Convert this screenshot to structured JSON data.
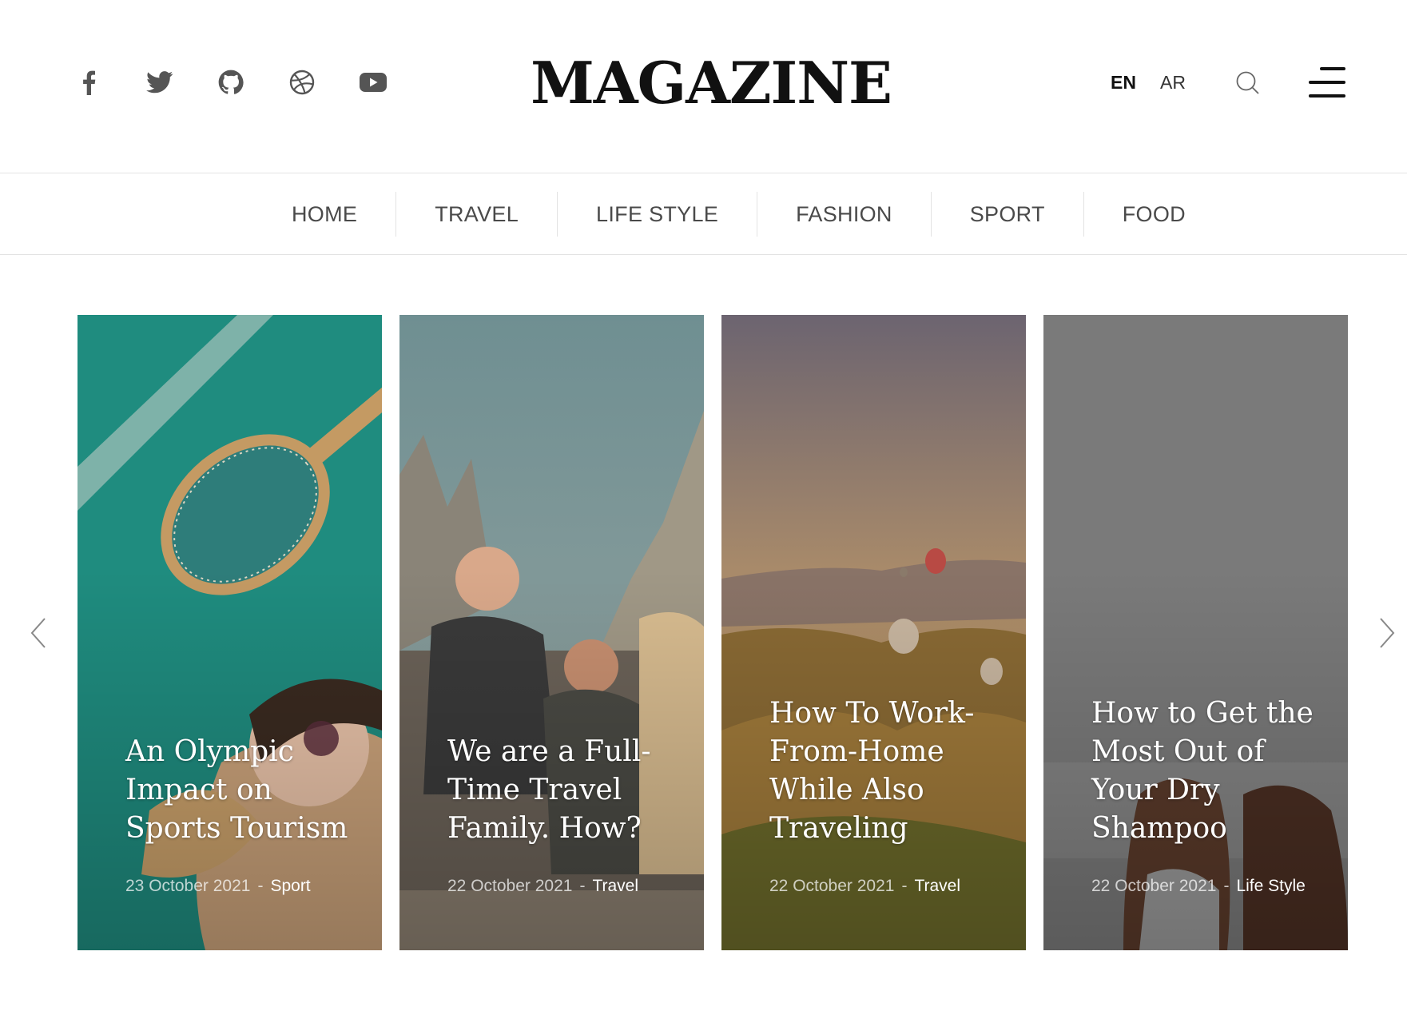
{
  "header": {
    "logo": "MAGAZINE",
    "socials": [
      {
        "icon": "facebook-icon"
      },
      {
        "icon": "twitter-icon"
      },
      {
        "icon": "github-icon"
      },
      {
        "icon": "dribbble-icon"
      },
      {
        "icon": "youtube-icon"
      }
    ],
    "lang_en": "EN",
    "lang_ar": "AR",
    "search_icon": "search-icon",
    "menu_icon": "hamburger-menu-icon"
  },
  "nav": {
    "items": [
      {
        "label": "HOME"
      },
      {
        "label": "TRAVEL"
      },
      {
        "label": "LIFE STYLE"
      },
      {
        "label": "FASHION"
      },
      {
        "label": "SPORT"
      },
      {
        "label": "FOOD"
      }
    ]
  },
  "slider": {
    "prev_icon": "chevron-left-icon",
    "next_icon": "chevron-right-icon",
    "cards": [
      {
        "title": "An Olympic Impact on Sports Tourism",
        "date": "23 October 2021",
        "separator": "-",
        "category": "Sport"
      },
      {
        "title": "We are a Full-Time Travel Family. How?",
        "date": "22 October 2021",
        "separator": "-",
        "category": "Travel"
      },
      {
        "title": "How To Work-From-Home While Also Traveling",
        "date": "22 October 2021",
        "separator": "-",
        "category": "Travel"
      },
      {
        "title": "How to Get the Most Out of Your Dry Shampoo",
        "date": "22 October 2021",
        "separator": "-",
        "category": "Life Style"
      }
    ]
  },
  "colors": {
    "text_dark": "#111111",
    "nav_text": "#4a4a4a",
    "divider": "#e3e3e3",
    "card1_bg": "#1f8c7f",
    "card2_bg": "#7c8a88",
    "card3_bg": "#8e7650",
    "card4_bg": "#7a7a7a"
  }
}
